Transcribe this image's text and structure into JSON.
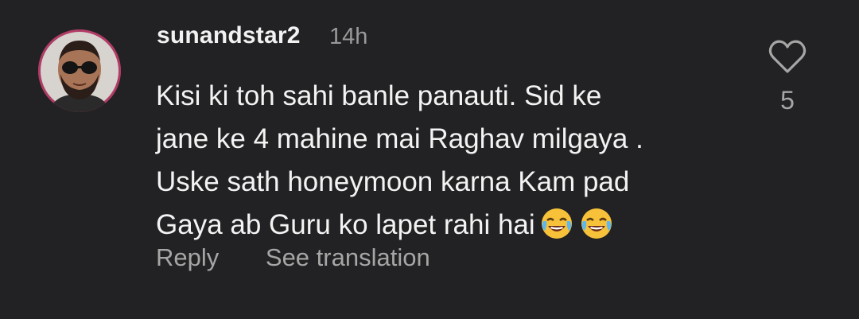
{
  "comment": {
    "username": "sunandstar2",
    "timestamp": "14h",
    "text_lines": [
      "Kisi ki toh sahi banle panauti. Sid ke",
      "jane ke 4 mahine mai Raghav milgaya .",
      "Uske sath honeymoon karna Kam pad",
      "Gaya ab Guru ko lapet rahi hai"
    ],
    "emojis": [
      "face-with-tears-of-joy-icon",
      "face-with-tears-of-joy-icon"
    ],
    "reply_label": "Reply",
    "translate_label": "See translation",
    "like_count": "5",
    "like_icon": "heart-outline-icon"
  },
  "colors": {
    "background": "#222123",
    "primary_text": "#f3f3f3",
    "secondary_text": "#a6a6a6",
    "avatar_ring": "#b03c66"
  }
}
